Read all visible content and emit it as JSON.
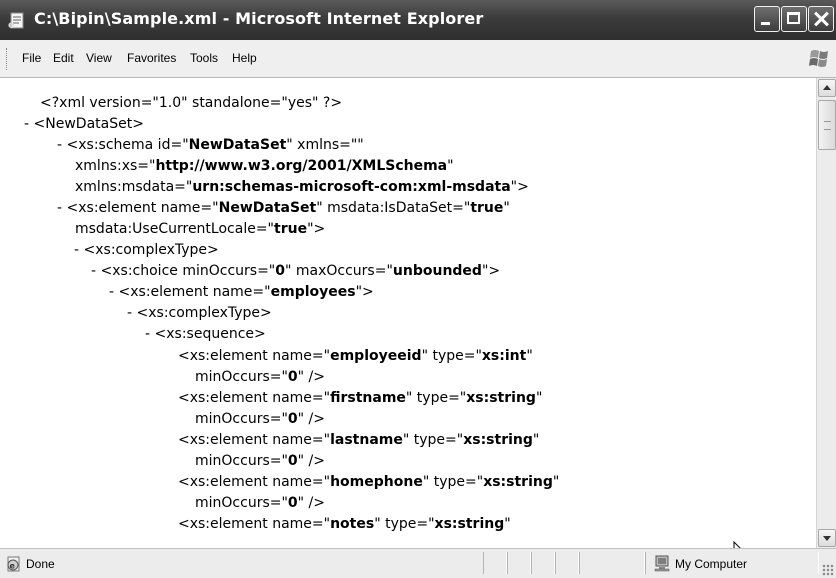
{
  "window": {
    "title": "C:\\Bipin\\Sample.xml - Microsoft Internet Explorer"
  },
  "menu": [
    "File",
    "Edit",
    "View",
    "Favorites",
    "Tools",
    "Help"
  ],
  "xml_lines": [
    {
      "parts": [
        {
          "t": "<?xml version=\"1.0\" standalone=\"yes\" ?>"
        }
      ]
    },
    {
      "dash": "- ",
      "parts": [
        {
          "t": "<NewDataSet>"
        }
      ]
    },
    {
      "dash": "- ",
      "parts": [
        {
          "t": "<xs:schema id=\""
        },
        {
          "t": "NewDataSet",
          "b": true
        },
        {
          "t": "\" xmlns=\"\""
        }
      ]
    },
    {
      "parts": [
        {
          "t": "xmlns:xs=\""
        },
        {
          "t": "http://www.w3.org/2001/XMLSchema",
          "b": true
        },
        {
          "t": "\""
        }
      ]
    },
    {
      "parts": [
        {
          "t": "xmlns:msdata=\""
        },
        {
          "t": "urn:schemas-microsoft-com:xml-msdata",
          "b": true
        },
        {
          "t": "\">"
        }
      ]
    },
    {
      "dash": "- ",
      "parts": [
        {
          "t": "<xs:element name=\""
        },
        {
          "t": "NewDataSet",
          "b": true
        },
        {
          "t": "\" msdata:IsDataSet=\""
        },
        {
          "t": "true",
          "b": true
        },
        {
          "t": "\""
        }
      ]
    },
    {
      "parts": [
        {
          "t": "msdata:UseCurrentLocale=\""
        },
        {
          "t": "true",
          "b": true
        },
        {
          "t": "\">"
        }
      ]
    },
    {
      "dash": "- ",
      "parts": [
        {
          "t": "<xs:complexType>"
        }
      ]
    },
    {
      "dash": "- ",
      "parts": [
        {
          "t": "<xs:choice minOccurs=\""
        },
        {
          "t": "0",
          "b": true
        },
        {
          "t": "\" maxOccurs=\""
        },
        {
          "t": "unbounded",
          "b": true
        },
        {
          "t": "\">"
        }
      ]
    },
    {
      "dash": "- ",
      "parts": [
        {
          "t": "<xs:element name=\""
        },
        {
          "t": "employees",
          "b": true
        },
        {
          "t": "\">"
        }
      ]
    },
    {
      "dash": "- ",
      "parts": [
        {
          "t": "<xs:complexType>"
        }
      ]
    },
    {
      "dash": "- ",
      "parts": [
        {
          "t": "<xs:sequence>"
        }
      ]
    },
    {
      "parts": [
        {
          "t": "<xs:element name=\""
        },
        {
          "t": "employeeid",
          "b": true
        },
        {
          "t": "\" type=\""
        },
        {
          "t": "xs:int",
          "b": true
        },
        {
          "t": "\""
        }
      ]
    },
    {
      "parts": [
        {
          "t": "minOccurs=\""
        },
        {
          "t": "0",
          "b": true
        },
        {
          "t": "\" />"
        }
      ]
    },
    {
      "parts": [
        {
          "t": "<xs:element name=\""
        },
        {
          "t": "firstname",
          "b": true
        },
        {
          "t": "\" type=\""
        },
        {
          "t": "xs:string",
          "b": true
        },
        {
          "t": "\""
        }
      ]
    },
    {
      "parts": [
        {
          "t": "minOccurs=\""
        },
        {
          "t": "0",
          "b": true
        },
        {
          "t": "\" />"
        }
      ]
    },
    {
      "parts": [
        {
          "t": "<xs:element name=\""
        },
        {
          "t": "lastname",
          "b": true
        },
        {
          "t": "\" type=\""
        },
        {
          "t": "xs:string",
          "b": true
        },
        {
          "t": "\""
        }
      ]
    },
    {
      "parts": [
        {
          "t": "minOccurs=\""
        },
        {
          "t": "0",
          "b": true
        },
        {
          "t": "\" />"
        }
      ]
    },
    {
      "parts": [
        {
          "t": "<xs:element name=\""
        },
        {
          "t": "homephone",
          "b": true
        },
        {
          "t": "\" type=\""
        },
        {
          "t": "xs:string",
          "b": true
        },
        {
          "t": "\""
        }
      ]
    },
    {
      "parts": [
        {
          "t": "minOccurs=\""
        },
        {
          "t": "0",
          "b": true
        },
        {
          "t": "\" />"
        }
      ]
    },
    {
      "parts": [
        {
          "t": "<xs:element name=\""
        },
        {
          "t": "notes",
          "b": true
        },
        {
          "t": "\" type=\""
        },
        {
          "t": "xs:string",
          "b": true
        },
        {
          "t": "\""
        }
      ]
    }
  ],
  "status": {
    "text": "Done",
    "zone": "My Computer"
  },
  "icons": {
    "app": "ie-document-icon",
    "status": "ie-globe-icon",
    "zone": "my-computer-icon",
    "brand": "windows-flag-icon"
  }
}
